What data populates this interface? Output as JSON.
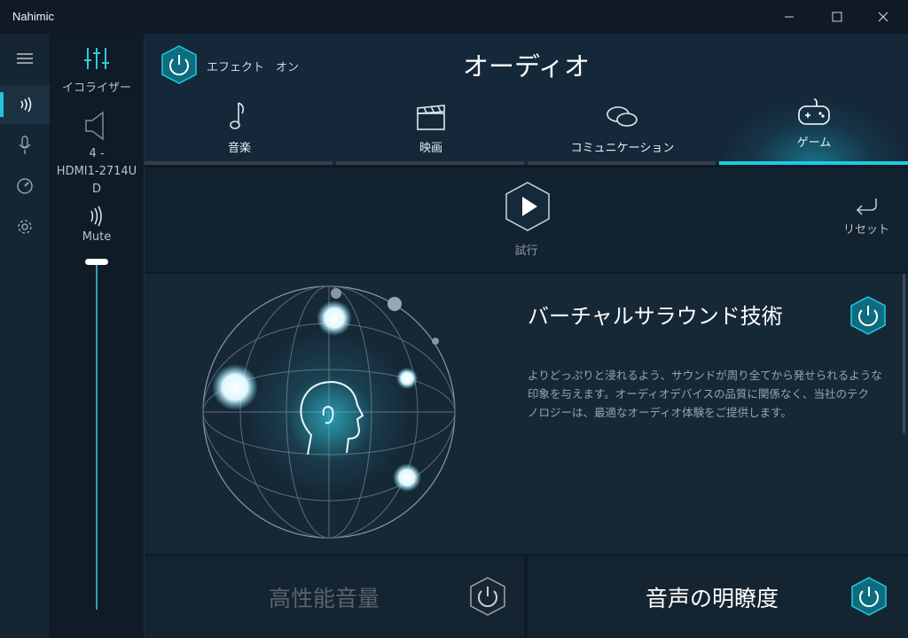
{
  "app": {
    "title": "Nahimic"
  },
  "window": {
    "minimize": "—",
    "maximize": "☐",
    "close": "✕"
  },
  "nav": {
    "items": [
      {
        "icon": "hamburger-icon"
      },
      {
        "icon": "audio-wave-icon",
        "active": true
      },
      {
        "icon": "microphone-icon"
      },
      {
        "icon": "gauge-icon"
      },
      {
        "icon": "gear-icon"
      }
    ]
  },
  "device": {
    "equalizer_label": "イコライザー",
    "device_name_line1": "4 -",
    "device_name_line2": "HDMI1-2714U",
    "device_name_line3": "D",
    "mute_label": "Mute",
    "volume_level": 1.0
  },
  "header": {
    "effect_label": "エフェクト　オン",
    "page_title": "オーディオ"
  },
  "tabs": [
    {
      "label": "音楽",
      "icon": "music-note-icon"
    },
    {
      "label": "映画",
      "icon": "clapperboard-icon"
    },
    {
      "label": "コミュニケーション",
      "icon": "chat-bubbles-icon"
    },
    {
      "label": "ゲーム",
      "icon": "gamepad-icon",
      "active": true
    }
  ],
  "test": {
    "label": "試行",
    "reset_label": "リセット"
  },
  "surround": {
    "title": "バーチャルサラウンド技術",
    "description_line1": "よりどっぷりと浸れるよう、サウンドが周り全てから発せられるような",
    "description_line2": "印象を与えます。オーディオデバイスの品質に関係なく、当社のテク",
    "description_line3": "ノロジーは、最適なオーディオ体験をご提供します。"
  },
  "bottom": {
    "left_title": "高性能音量",
    "right_title": "音声の明瞭度"
  },
  "colors": {
    "accent": "#1ecbe2",
    "background": "#0f1c27",
    "hex_fill": "#0d6c7e"
  }
}
